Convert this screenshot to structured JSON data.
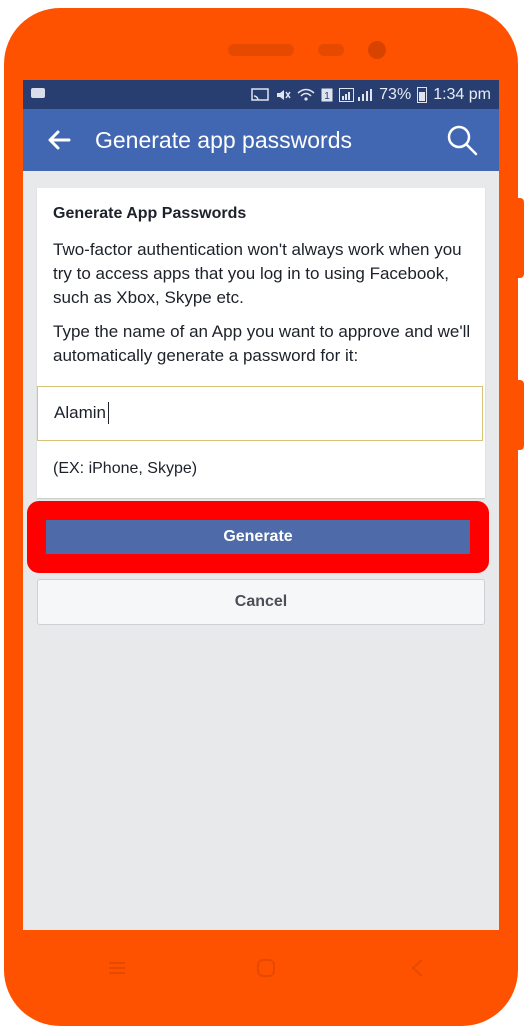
{
  "status_bar": {
    "battery": "73%",
    "time": "1:34 pm",
    "icons": [
      "video-icon",
      "cast-icon",
      "mute-icon",
      "wifi-icon",
      "sim-icon",
      "signal-icon",
      "battery-icon"
    ]
  },
  "app_bar": {
    "title": "Generate app passwords",
    "back_icon": "arrow-left-icon",
    "search_icon": "search-icon"
  },
  "card": {
    "heading": "Generate App Passwords",
    "paragraph1": "Two-factor authentication won't always work when you try to access apps that you log in to using Facebook, such as Xbox, Skype etc.",
    "paragraph2": "Type the name of an App you want to approve and we'll automatically generate a password for it:"
  },
  "input": {
    "value": "Alamin",
    "hint": "(EX: iPhone, Skype)"
  },
  "buttons": {
    "generate": "Generate",
    "cancel": "Cancel"
  },
  "colors": {
    "phone_body": "#ff5200",
    "status_bar": "#283e70",
    "app_bar": "#4267b2",
    "generate_button": "#4e6aa8",
    "highlight": "#ff0000"
  }
}
